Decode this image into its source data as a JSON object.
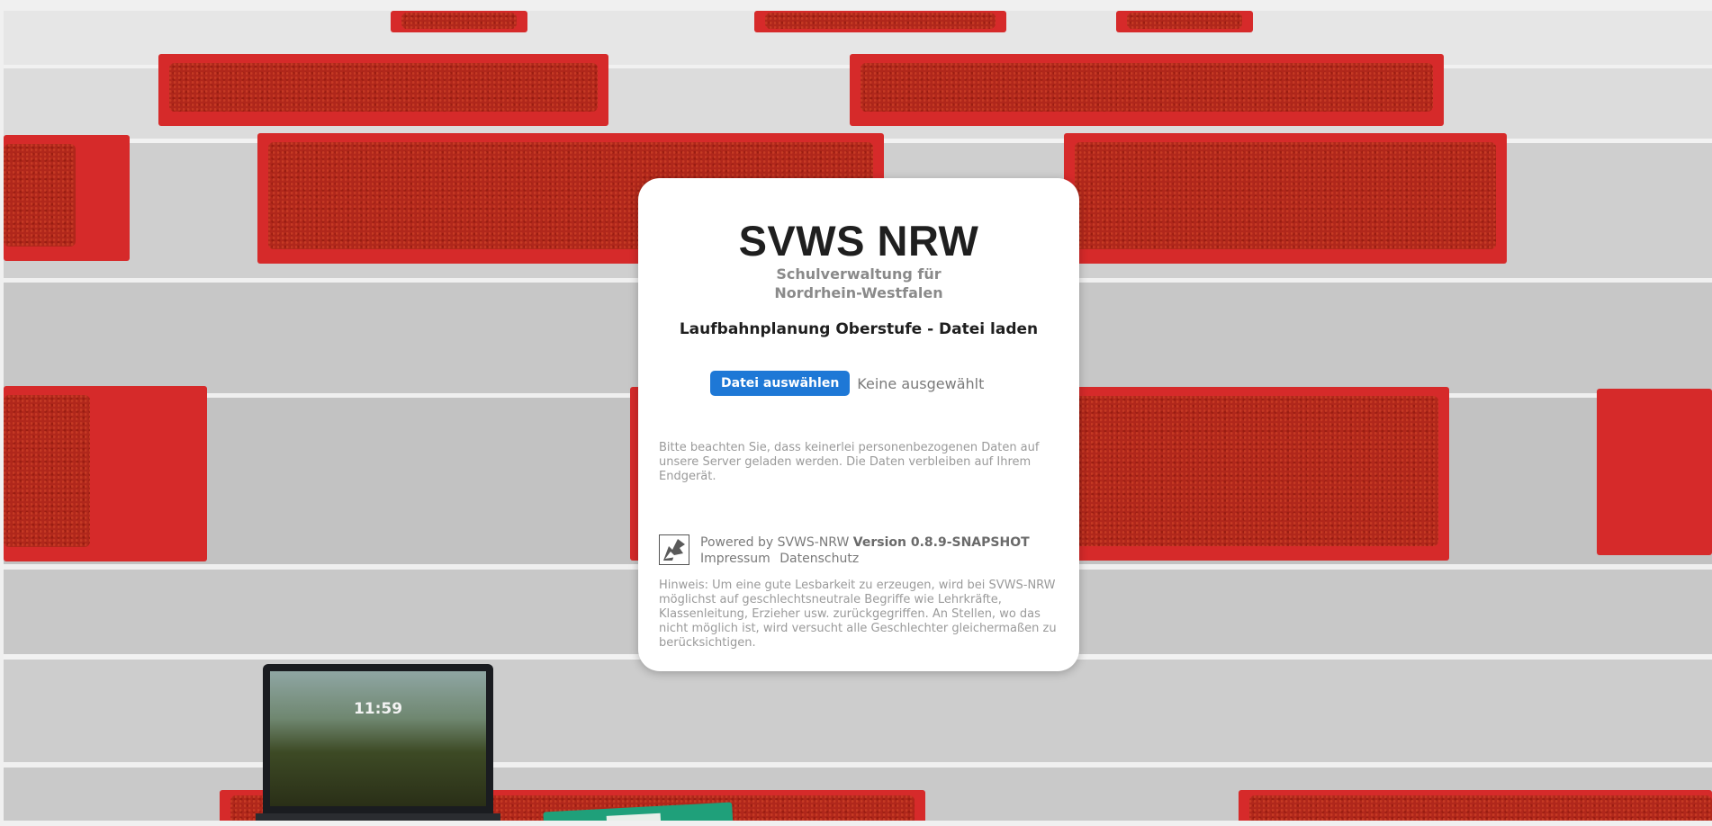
{
  "app": {
    "title": "SVWS NRW",
    "subtitle_line1": "Schulverwaltung für",
    "subtitle_line2": "Nordrhein-Westfalen"
  },
  "page": {
    "heading": "Laufbahnplanung Oberstufe - Datei laden"
  },
  "file_input": {
    "button_label": "Datei auswählen",
    "status": "Keine ausgewählt"
  },
  "notice": "Bitte beachten Sie, dass keinerlei personenbezogenen Daten auf unsere Server geladen werden. Die Daten verbleiben auf Ihrem Endgerät.",
  "footer": {
    "powered_by": "Powered by SVWS-NRW",
    "version": "Version 0.8.9-SNAPSHOT",
    "links": [
      "Impressum",
      "Datenschutz"
    ],
    "logo_icon": "nrw-logo-icon"
  },
  "hint": "Hinweis: Um eine gute Lesbarkeit zu erzeugen, wird bei SVWS-NRW möglichst auf geschlechtsneutrale Begriffe wie Lehrkräfte, Klassenleitung, Erzieher usw. zurückgegriffen. An Stellen, wo das nicht möglich ist, wird versucht alle Geschlechter gleichermaßen zu berücksichtigen.",
  "background": {
    "laptop_time": "11:59"
  },
  "colors": {
    "accent": "#1e78d6",
    "bench_red": "#d62a2a"
  }
}
